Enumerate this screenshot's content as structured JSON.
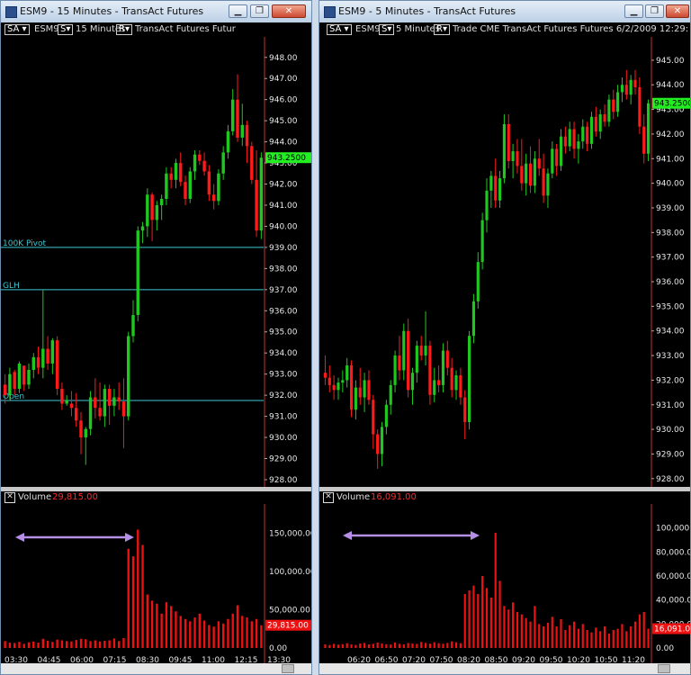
{
  "left": {
    "title": "ESM9 - 15 Minutes - TransAct Futures",
    "toolbar": {
      "sa": "SA ▾",
      "symbol": "ESM9",
      "s": "S▾",
      "interval": "15 Minutes",
      "r": "R▾",
      "extra": "TransAct Futures  Futur"
    },
    "volume_label": "Volume",
    "volume_value": "29,815.00"
  },
  "right": {
    "title": "ESM9 - 5 Minutes - TransAct Futures",
    "toolbar": {
      "sa": "SA ▾",
      "symbol": "ESM9",
      "s": "S▾",
      "interval": "5 Minutes",
      "r": "R▾",
      "extra": "Trade  CME  TransAct Futures  Futures  6/2/2009  12:29:"
    },
    "volume_label": "Volume",
    "volume_value": "16,091.00"
  },
  "colors": {
    "up": "#1fc81f",
    "down": "#ff1a1a",
    "doji": "#cccccc",
    "hline": "#3cc8d0",
    "arrow": "#b58ee6",
    "price_tag": "#22ee22",
    "vol_tag": "#ee1111"
  },
  "chart_data": [
    {
      "type": "candlestick",
      "title": "ESM9 - 15 Minutes - TransAct Futures",
      "price_axis": {
        "min": 927.7,
        "max": 948.8,
        "ticks": [
          "948.00",
          "947.00",
          "946.00",
          "945.00",
          "944.00",
          "943.00",
          "942.00",
          "941.00",
          "940.00",
          "939.00",
          "938.00",
          "937.00",
          "936.00",
          "935.00",
          "934.00",
          "933.00",
          "932.00",
          "931.00",
          "930.00",
          "929.00",
          "928.00"
        ]
      },
      "time_ticks": [
        "03:30",
        "04:45",
        "06:00",
        "07:15",
        "08:30",
        "09:45",
        "11:00",
        "12:15",
        "13:30"
      ],
      "last_price": "943.2500",
      "levels": [
        {
          "label": "100K Pivot",
          "value": 939.0
        },
        {
          "label": "GLH",
          "value": 937.0
        },
        {
          "label": "Open",
          "value": 931.75
        }
      ],
      "ohlc": [
        [
          932.5,
          933.0,
          931.6,
          932.0
        ],
        [
          932.0,
          933.3,
          931.8,
          933.0
        ],
        [
          933.1,
          933.2,
          932.0,
          932.3
        ],
        [
          932.3,
          933.6,
          932.1,
          933.5
        ],
        [
          933.4,
          933.4,
          932.2,
          932.5
        ],
        [
          932.5,
          933.5,
          932.3,
          933.2
        ],
        [
          933.2,
          934.0,
          932.8,
          933.8
        ],
        [
          933.8,
          934.3,
          933.0,
          933.3
        ],
        [
          933.3,
          937.0,
          932.8,
          934.2
        ],
        [
          934.2,
          934.8,
          933.2,
          933.5
        ],
        [
          933.5,
          934.7,
          933.0,
          934.6
        ],
        [
          934.6,
          934.8,
          932.0,
          932.3
        ],
        [
          932.3,
          932.6,
          931.3,
          931.6
        ],
        [
          931.6,
          932.0,
          931.5,
          931.75
        ],
        [
          931.6,
          932.2,
          931.0,
          931.4
        ],
        [
          931.4,
          932.1,
          930.5,
          930.8
        ],
        [
          930.8,
          931.2,
          929.2,
          930.0
        ],
        [
          930.0,
          930.5,
          928.7,
          930.4
        ],
        [
          930.4,
          932.2,
          930.1,
          931.9
        ],
        [
          931.9,
          932.8,
          930.9,
          931.4
        ],
        [
          931.4,
          932.6,
          930.8,
          931.0
        ],
        [
          931.0,
          932.5,
          930.5,
          932.3
        ],
        [
          932.3,
          932.5,
          930.6,
          931.5
        ],
        [
          931.5,
          932.3,
          931.0,
          931.9
        ],
        [
          931.9,
          932.6,
          931.3,
          931.7
        ],
        [
          931.7,
          932.8,
          929.5,
          931.0
        ],
        [
          931.0,
          935.0,
          930.8,
          934.8
        ],
        [
          934.8,
          936.5,
          934.5,
          935.8
        ],
        [
          935.8,
          940.0,
          935.5,
          939.8
        ],
        [
          939.8,
          940.2,
          939.2,
          940.0
        ],
        [
          940.0,
          941.8,
          939.5,
          941.5
        ],
        [
          941.5,
          941.6,
          939.3,
          940.3
        ],
        [
          940.3,
          941.2,
          939.8,
          941.0
        ],
        [
          941.0,
          941.5,
          940.3,
          941.3
        ],
        [
          941.3,
          942.8,
          941.0,
          942.5
        ],
        [
          942.5,
          942.8,
          941.8,
          942.2
        ],
        [
          942.2,
          943.2,
          941.8,
          943.0
        ],
        [
          943.0,
          943.5,
          941.9,
          942.1
        ],
        [
          942.1,
          942.4,
          941.0,
          941.3
        ],
        [
          941.3,
          942.8,
          941.1,
          942.6
        ],
        [
          942.6,
          943.6,
          942.2,
          943.4
        ],
        [
          943.4,
          943.6,
          942.9,
          943.1
        ],
        [
          943.1,
          943.5,
          942.4,
          942.6
        ],
        [
          942.6,
          942.9,
          941.2,
          941.5
        ],
        [
          941.5,
          942.0,
          940.8,
          941.2
        ],
        [
          941.2,
          942.7,
          941.0,
          942.5
        ],
        [
          942.5,
          943.8,
          942.2,
          943.5
        ],
        [
          943.5,
          944.8,
          943.2,
          944.5
        ],
        [
          944.5,
          946.5,
          944.3,
          946.0
        ],
        [
          946.0,
          947.2,
          944.0,
          944.2
        ],
        [
          944.2,
          945.8,
          943.8,
          944.8
        ],
        [
          944.8,
          945.0,
          943.0,
          943.8
        ],
        [
          943.8,
          944.0,
          942.0,
          942.2
        ],
        [
          942.2,
          943.6,
          939.5,
          939.8
        ],
        [
          939.8,
          943.5,
          939.4,
          943.25
        ]
      ],
      "volume": {
        "axis_ticks": [
          "150,000.00",
          "100,000.00",
          "50,000.00",
          "0.00"
        ],
        "max": 165000,
        "last": "29,815.00",
        "values": [
          9000,
          7000,
          6500,
          8000,
          5500,
          7500,
          8500,
          7000,
          12000,
          9500,
          8000,
          11000,
          10000,
          9000,
          8500,
          10500,
          12000,
          11500,
          9000,
          10000,
          8500,
          9500,
          10000,
          12500,
          9000,
          13000,
          130000,
          120000,
          155000,
          135000,
          70000,
          62000,
          58000,
          45000,
          60000,
          55000,
          48000,
          42000,
          38000,
          35000,
          40000,
          45000,
          36000,
          30000,
          28000,
          35000,
          32000,
          38000,
          45000,
          56000,
          42000,
          40000,
          35000,
          38000,
          29815
        ]
      }
    },
    {
      "type": "candlestick",
      "title": "ESM9 - 5 Minutes - TransAct Futures",
      "price_axis": {
        "min": 927.7,
        "max": 945.8,
        "ticks": [
          "945.00",
          "944.00",
          "943.00",
          "942.00",
          "941.00",
          "940.00",
          "939.00",
          "938.00",
          "937.00",
          "936.00",
          "935.00",
          "934.00",
          "933.00",
          "932.00",
          "931.00",
          "930.00",
          "929.00",
          "928.00"
        ]
      },
      "time_ticks": [
        "06:20",
        "06:50",
        "07:20",
        "07:50",
        "08:20",
        "08:50",
        "09:20",
        "09:50",
        "10:20",
        "10:50",
        "11:20"
      ],
      "last_price": "943.2500",
      "ohlc": [
        [
          932.3,
          933.0,
          931.8,
          932.1
        ],
        [
          932.1,
          932.6,
          931.5,
          931.8
        ],
        [
          931.8,
          932.2,
          931.2,
          931.6
        ],
        [
          931.6,
          932.1,
          931.2,
          931.9
        ],
        [
          931.9,
          932.4,
          931.5,
          932.0
        ],
        [
          932.0,
          932.9,
          931.7,
          932.6
        ],
        [
          932.6,
          932.8,
          930.5,
          930.8
        ],
        [
          930.8,
          932.0,
          930.4,
          931.7
        ],
        [
          931.7,
          932.5,
          931.0,
          931.3
        ],
        [
          931.3,
          932.3,
          930.7,
          932.0
        ],
        [
          932.0,
          932.4,
          931.0,
          931.2
        ],
        [
          931.2,
          931.4,
          929.2,
          929.8
        ],
        [
          929.8,
          930.0,
          928.4,
          929.0
        ],
        [
          929.0,
          930.3,
          928.5,
          930.1
        ],
        [
          930.1,
          931.2,
          929.8,
          931.0
        ],
        [
          931.0,
          932.0,
          930.6,
          931.8
        ],
        [
          931.8,
          933.2,
          931.5,
          933.0
        ],
        [
          933.0,
          933.8,
          932.0,
          932.4
        ],
        [
          932.4,
          934.3,
          932.0,
          934.0
        ],
        [
          934.0,
          934.5,
          931.3,
          931.6
        ],
        [
          931.6,
          932.5,
          931.0,
          932.3
        ],
        [
          932.3,
          933.6,
          931.9,
          933.4
        ],
        [
          933.4,
          933.8,
          932.8,
          933.0
        ],
        [
          933.0,
          934.8,
          932.6,
          933.4
        ],
        [
          933.4,
          933.6,
          931.0,
          931.4
        ],
        [
          931.4,
          932.5,
          931.1,
          932.0
        ],
        [
          932.0,
          932.6,
          931.5,
          931.8
        ],
        [
          931.8,
          933.5,
          931.5,
          933.2
        ],
        [
          933.2,
          933.6,
          932.2,
          932.5
        ],
        [
          932.5,
          932.9,
          931.3,
          931.6
        ],
        [
          931.6,
          932.4,
          931.2,
          932.2
        ],
        [
          932.2,
          932.5,
          931.0,
          931.3
        ],
        [
          931.3,
          931.6,
          929.6,
          930.3
        ],
        [
          930.3,
          934.0,
          930.0,
          933.8
        ],
        [
          933.8,
          935.5,
          933.5,
          935.2
        ],
        [
          935.2,
          937.2,
          934.9,
          936.8
        ],
        [
          936.8,
          938.8,
          936.5,
          938.5
        ],
        [
          938.5,
          940.2,
          938.0,
          939.7
        ],
        [
          939.7,
          940.5,
          939.0,
          940.3
        ],
        [
          940.3,
          941.0,
          939.0,
          939.3
        ],
        [
          939.3,
          940.5,
          939.0,
          940.2
        ],
        [
          940.2,
          942.8,
          940.0,
          942.4
        ],
        [
          942.4,
          942.8,
          940.6,
          940.9
        ],
        [
          940.9,
          941.6,
          940.2,
          941.3
        ],
        [
          941.3,
          941.8,
          940.4,
          940.7
        ],
        [
          940.7,
          941.8,
          939.7,
          940.0
        ],
        [
          940.0,
          941.2,
          939.5,
          940.8
        ],
        [
          940.8,
          941.5,
          939.6,
          939.9
        ],
        [
          939.9,
          941.3,
          939.6,
          941.0
        ],
        [
          941.0,
          941.8,
          940.3,
          940.6
        ],
        [
          940.6,
          941.2,
          939.2,
          939.5
        ],
        [
          939.5,
          940.6,
          939.0,
          940.4
        ],
        [
          940.4,
          941.7,
          940.2,
          941.4
        ],
        [
          941.4,
          941.6,
          940.3,
          940.7
        ],
        [
          940.7,
          942.2,
          940.5,
          941.9
        ],
        [
          941.9,
          942.3,
          941.2,
          941.5
        ],
        [
          941.5,
          942.5,
          941.3,
          942.2
        ],
        [
          942.2,
          942.5,
          941.0,
          941.4
        ],
        [
          941.4,
          942.0,
          940.8,
          941.7
        ],
        [
          941.7,
          942.6,
          941.4,
          942.3
        ],
        [
          942.3,
          942.5,
          941.3,
          941.6
        ],
        [
          941.6,
          942.9,
          941.4,
          942.7
        ],
        [
          942.7,
          943.1,
          941.9,
          942.1
        ],
        [
          942.1,
          943.0,
          941.8,
          942.8
        ],
        [
          942.8,
          943.2,
          942.3,
          942.5
        ],
        [
          942.5,
          943.6,
          942.3,
          943.4
        ],
        [
          943.4,
          943.8,
          942.6,
          942.9
        ],
        [
          942.9,
          944.0,
          942.7,
          943.7
        ],
        [
          943.7,
          944.3,
          943.3,
          944.0
        ],
        [
          944.0,
          944.6,
          943.4,
          943.6
        ],
        [
          943.6,
          944.4,
          943.2,
          944.2
        ],
        [
          944.2,
          944.6,
          943.6,
          943.9
        ],
        [
          943.9,
          944.3,
          942.0,
          942.3
        ],
        [
          942.3,
          942.8,
          940.8,
          941.2
        ],
        [
          941.2,
          943.4,
          940.9,
          943.25
        ]
      ],
      "volume": {
        "axis_ticks": [
          "100,000.00",
          "80,000.00",
          "60,000.00",
          "40,000.00",
          "20,000.00",
          "0.00"
        ],
        "max": 105000,
        "last": "16,091.00",
        "values": [
          3000,
          2500,
          3500,
          2800,
          3200,
          4000,
          3000,
          2600,
          3800,
          4200,
          3000,
          3500,
          4500,
          3800,
          3200,
          2900,
          4600,
          3500,
          3000,
          4200,
          3800,
          3400,
          5000,
          4300,
          3600,
          4800,
          4000,
          3500,
          4200,
          5500,
          4800,
          4000,
          45000,
          48000,
          52000,
          45000,
          60000,
          50000,
          42000,
          96000,
          56000,
          35000,
          32000,
          38000,
          30000,
          28000,
          25000,
          22000,
          35000,
          20000,
          18000,
          21000,
          26000,
          18000,
          24000,
          15000,
          19000,
          22000,
          16000,
          20000,
          15000,
          13000,
          17000,
          14000,
          18000,
          12000,
          15000,
          16000,
          20000,
          14000,
          18000,
          22000,
          28000,
          30000,
          16091
        ]
      }
    }
  ]
}
